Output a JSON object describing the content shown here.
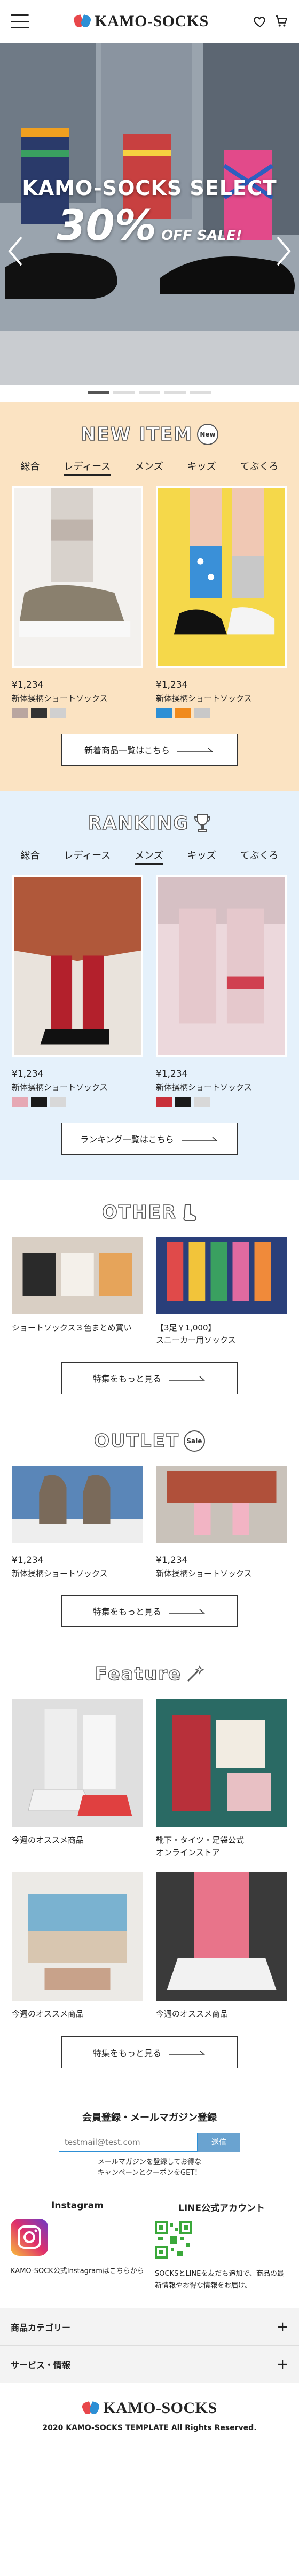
{
  "header": {
    "brand": "KAMO-SOCKS",
    "icons": [
      "menu-icon",
      "heart-icon",
      "cart-icon"
    ]
  },
  "hero": {
    "line1": "KAMO-SOCKS SELECT",
    "percent": "30%",
    "line2": "OFF SALE!",
    "slide_count": 5,
    "active_slide": 1
  },
  "new_item": {
    "title": "NEW ITEM",
    "badge": "New",
    "tabs": [
      "総合",
      "レディース",
      "メンズ",
      "キッズ",
      "てぶくろ"
    ],
    "active_tab": 1,
    "products": [
      {
        "price": "¥1,234",
        "name": "新体操柄ショートソックス",
        "swatches": [
          "#b9a6a0",
          "#333333",
          "#d0d0d0"
        ]
      },
      {
        "price": "¥1,234",
        "name": "新体操柄ショートソックス",
        "swatches": [
          "#2d8fd5",
          "#f08a1c",
          "#c8c8c8"
        ]
      }
    ],
    "button": "新着商品一覧はこちら"
  },
  "ranking": {
    "title": "RANKING",
    "tabs": [
      "総合",
      "レディース",
      "メンズ",
      "キッズ",
      "てぶくろ"
    ],
    "active_tab": 2,
    "products": [
      {
        "price": "¥1,234",
        "name": "新体操柄ショートソックス",
        "swatches": [
          "#e6a8b4",
          "#1a1a1a",
          "#d8d8d8"
        ]
      },
      {
        "price": "¥1,234",
        "name": "新体操柄ショートソックス",
        "swatches": [
          "#c8303a",
          "#1a1a1a",
          "#d8d8d8"
        ]
      }
    ],
    "button": "ランキング一覧はこちら"
  },
  "other": {
    "title": "OTHER",
    "items": [
      {
        "caption": "ショートソックス３色まとめ買い"
      },
      {
        "caption": "【3足￥1,000】\nスニーカー用ソックス"
      }
    ],
    "button": "特集をもっと見る"
  },
  "outlet": {
    "title": "OUTLET",
    "badge": "Sale",
    "products": [
      {
        "price": "¥1,234",
        "name": "新体操柄ショートソックス"
      },
      {
        "price": "¥1,234",
        "name": "新体操柄ショートソックス"
      }
    ],
    "button": "特集をもっと見る"
  },
  "feature": {
    "title": "Feature",
    "items": [
      {
        "caption": "今週のオススメ商品"
      },
      {
        "caption": "靴下・タイツ・足袋公式\nオンラインストア"
      },
      {
        "caption": "今週のオススメ商品"
      },
      {
        "caption": "今週のオススメ商品"
      }
    ],
    "button": "特集をもっと見る"
  },
  "newsletter": {
    "title": "会員登録・メールマガジン登録",
    "placeholder": "testmail@test.com",
    "submit": "送信",
    "note_line1": "メールマガジンを登録してお得な",
    "note_line2": "キャンペーンとクーポンをGET！"
  },
  "sns": {
    "instagram_title": "Instagram",
    "instagram_text": "KAMO-SOCK公式Instagramはこちらから",
    "line_title": "LINE公式アカウント",
    "line_text": "SOCKSとLINEを友だち追加で、商品の最新情報やお得な情報をお届け。"
  },
  "footer": {
    "accordions": [
      "商品カテゴリー",
      "サービス・情報"
    ],
    "brand": "KAMO-SOCKS",
    "copyright": "2020 KAMO-SOCKS TEMPLATE  All Rights Reserved."
  },
  "colors": {
    "peach": "#fbe3c2",
    "light_blue": "#e5f1fb",
    "brand_red": "#e8474b",
    "brand_blue": "#2d8fd5"
  }
}
